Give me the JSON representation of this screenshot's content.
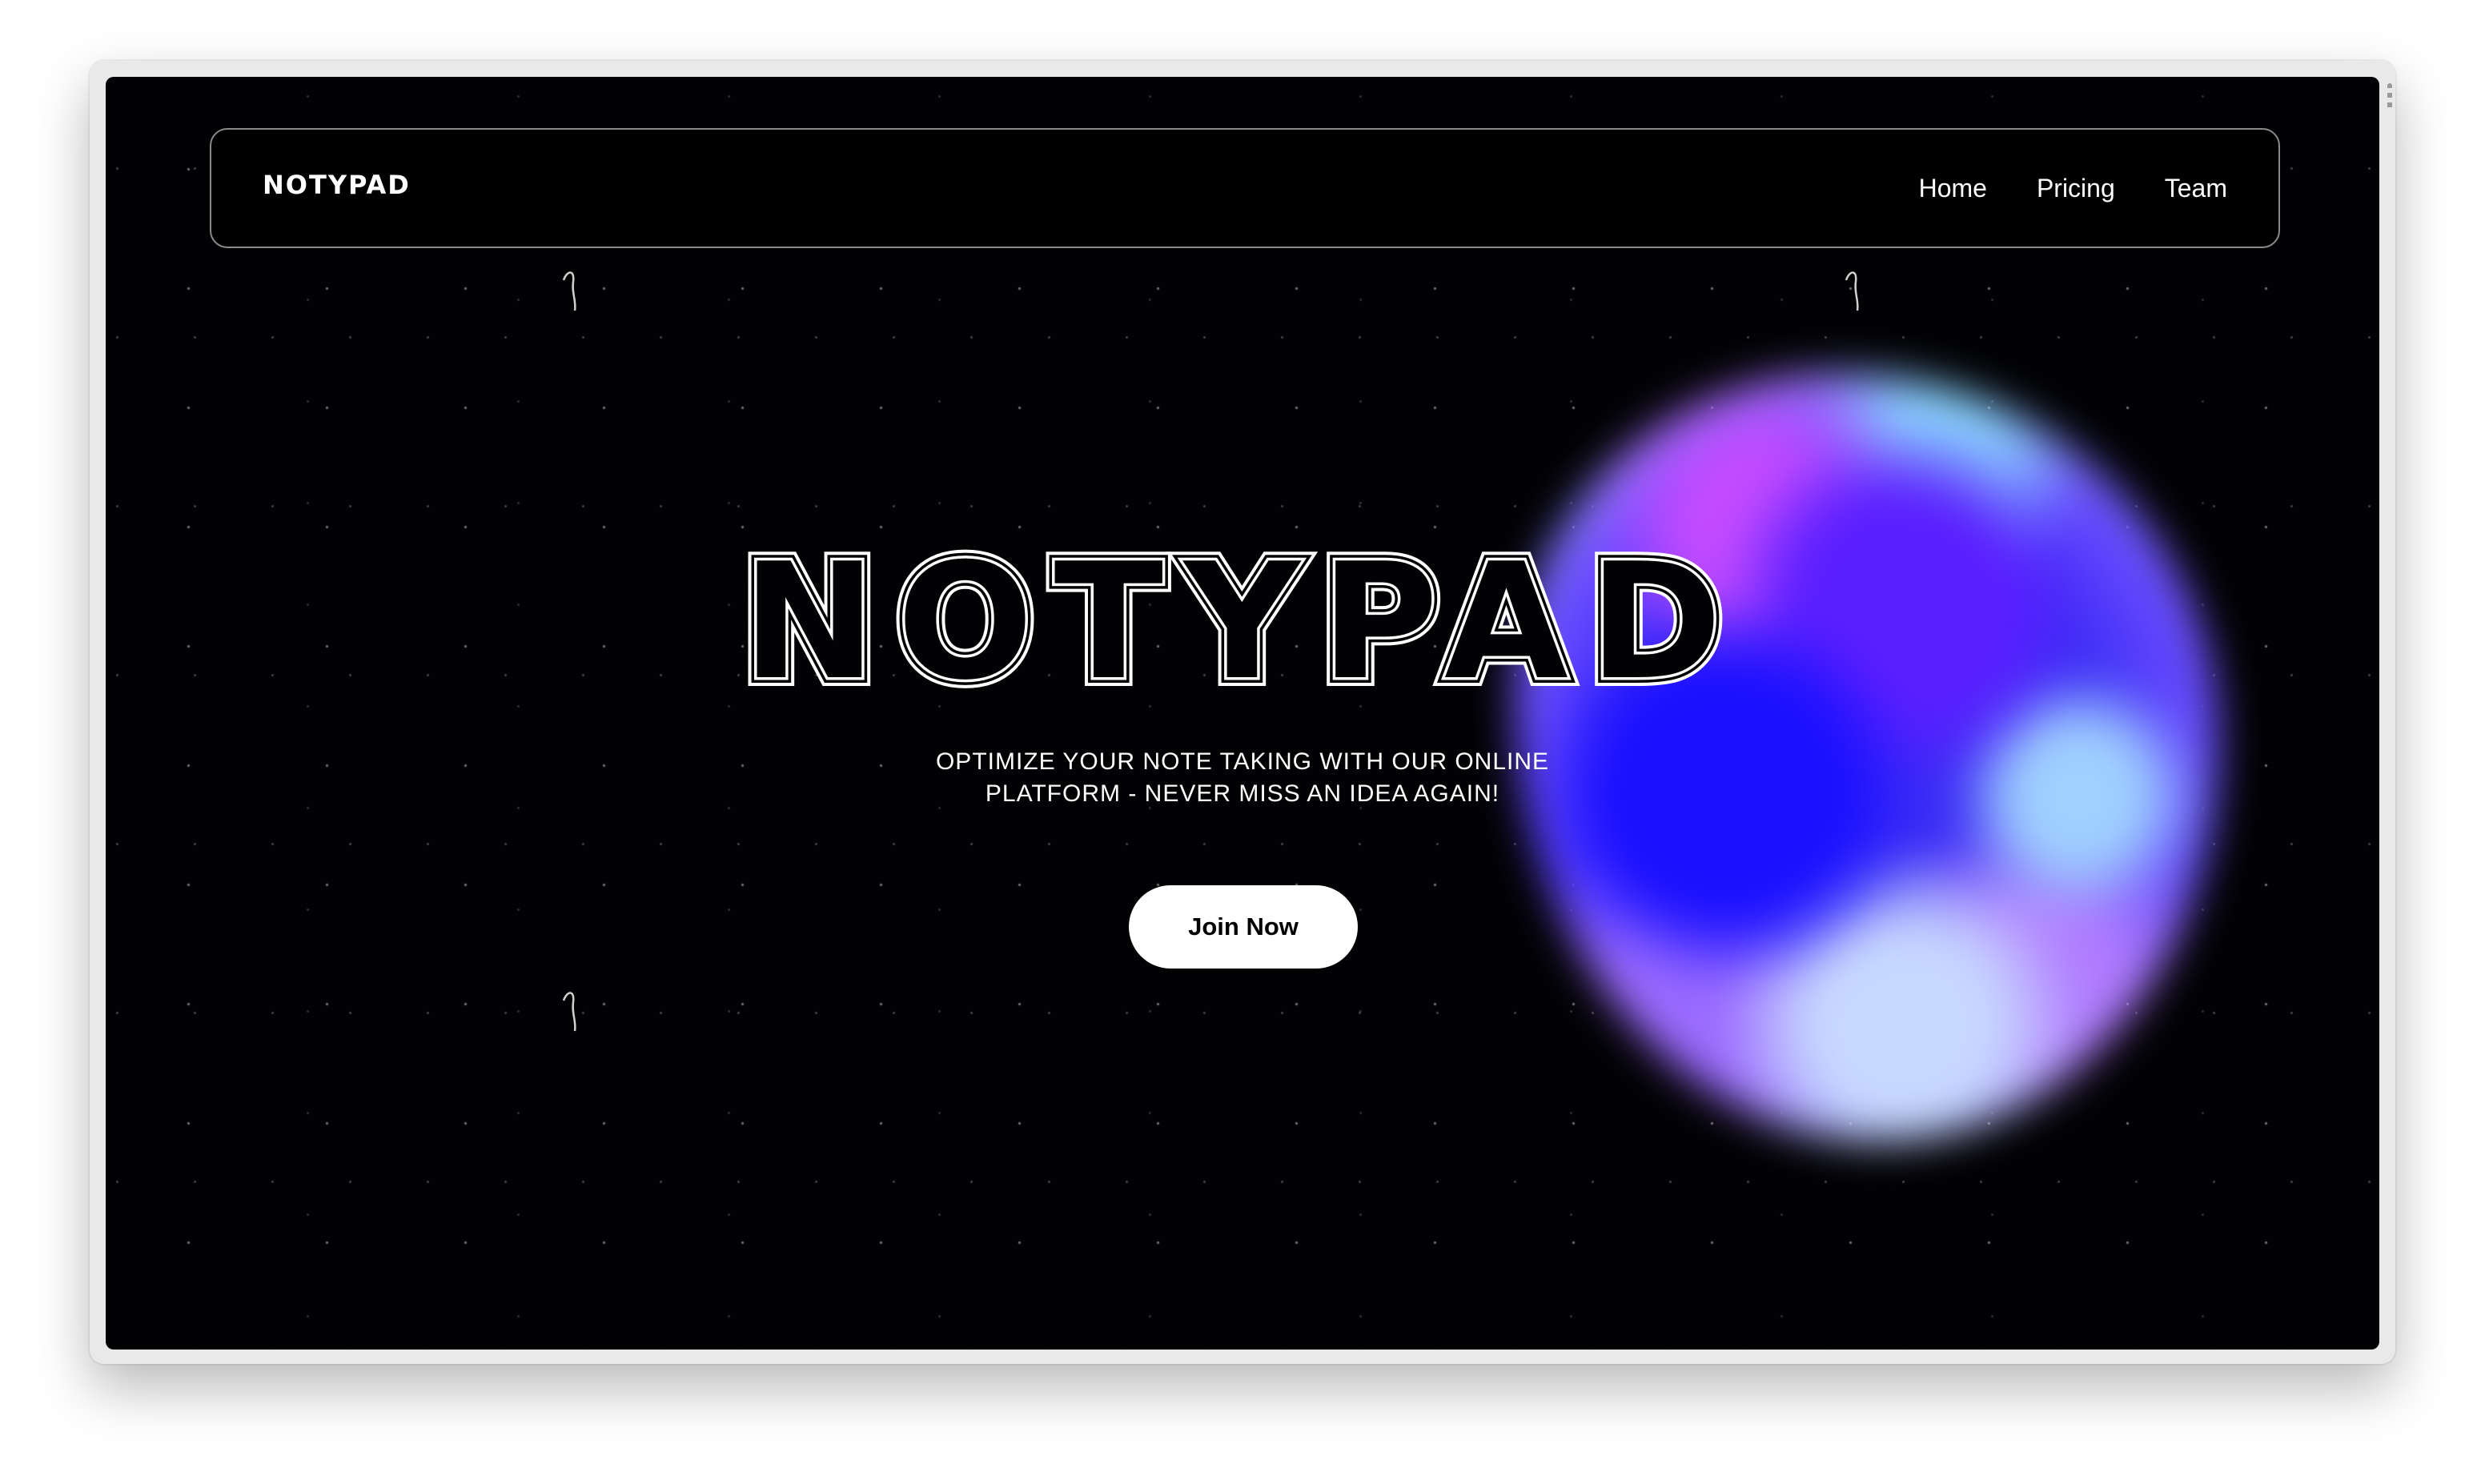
{
  "brand": {
    "name": "NOTYPAD"
  },
  "nav": {
    "links": [
      {
        "label": "Home"
      },
      {
        "label": "Pricing"
      },
      {
        "label": "Team"
      }
    ]
  },
  "hero": {
    "title": "NOTYPAD",
    "subtitle_line1": "OPTIMIZE YOUR NOTE TAKING WITH OUR ONLINE",
    "subtitle_line2": "PLATFORM - NEVER MISS AN IDEA AGAIN!",
    "cta_label": "Join Now"
  },
  "colors": {
    "background": "#020204",
    "text": "#ffffff",
    "nav_border": "#8a8a8a",
    "cta_background": "#ffffff",
    "blob_primary": "#3a2cf5",
    "blob_accent": "#c44bff"
  },
  "icons": {
    "decoration": "blurred-gradient-blob"
  }
}
